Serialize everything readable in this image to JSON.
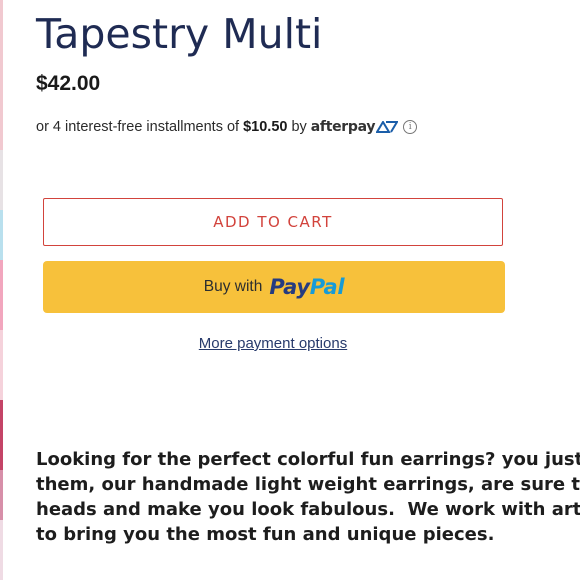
{
  "product": {
    "title": "Tapestry Multi",
    "price": "$42.00"
  },
  "afterpay": {
    "prefix": "or 4 interest-free installments of",
    "amount": "$10.50",
    "by": "by",
    "logo_text": "afterpay",
    "logo_icon": "afterpay-arrows-icon",
    "info_icon": "info-icon"
  },
  "actions": {
    "add_to_cart": "ADD TO CART",
    "paypal_prefix": "Buy with",
    "paypal_logo_pay": "Pay",
    "paypal_logo_pal": "Pal",
    "more_payment_options": "More payment options"
  },
  "description": {
    "lines": [
      "Looking for the perfect colorful fun earrings? you just",
      "them, our handmade light weight earrings, are sure to",
      "heads and make you look fabulous.  We work with art",
      "to bring you the most fun and unique pieces."
    ]
  },
  "colors": {
    "title": "#1f2b53",
    "add_to_cart_accent": "#d2433c",
    "paypal_button_bg": "#f7c13b",
    "paypal_blue_dark": "#253b80",
    "paypal_blue_light": "#179bd7",
    "link": "#273a6b"
  }
}
